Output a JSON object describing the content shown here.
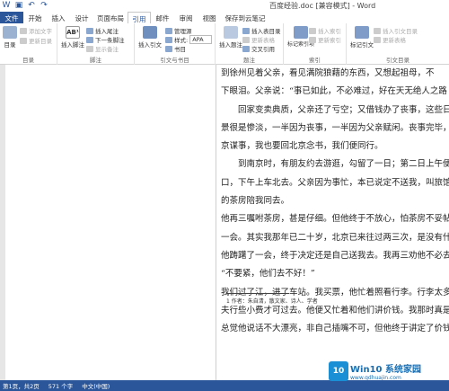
{
  "window": {
    "title": "百度经验.doc [兼容模式] - Word",
    "qat": [
      "save-icon",
      "undo-icon",
      "redo-icon"
    ]
  },
  "tabs": [
    "文件",
    "开始",
    "插入",
    "设计",
    "页面布局",
    "引用",
    "邮件",
    "审阅",
    "视图",
    "保存到云笔记"
  ],
  "active_tab": "引用",
  "ribbon": {
    "toc": {
      "big": "目录",
      "add_text": "添加文字",
      "update": "更新目录",
      "label": "目录"
    },
    "footnote": {
      "big": "插入脚注",
      "insert_endnote": "插入尾注",
      "next_footnote": "下一条脚注",
      "show_notes": "显示备注",
      "label": "脚注"
    },
    "citation": {
      "big": "插入引文",
      "manage": "管理源",
      "style_label": "样式:",
      "style_value": "APA",
      "biblio": "书目",
      "label": "引文与书目"
    },
    "caption": {
      "insert_caption": "插入题注",
      "insert_tof": "插入表目录",
      "update_table": "更新表格",
      "cross_ref": "交叉引用",
      "label": "题注"
    },
    "index": {
      "big": "标记索引项",
      "insert_index": "插入索引",
      "update_index": "更新索引",
      "label": "索引"
    },
    "toa": {
      "big": "标记引文",
      "insert_toa": "插入引文目录",
      "update_table": "更新表格",
      "label": "引文目录"
    }
  },
  "document": {
    "lines": [
      "到徐州见着父亲，看见满院狼藉的东西，又想起祖母，不",
      "下眼泪。父亲说：“事已如此，不必难过，好在天无绝人之路",
      "　　回家变卖典质，父亲还了亏空；又借钱办了丧事，这些日",
      "景很是惨淡，一半因为丧事，一半因为父亲赋闲。丧事完毕，",
      "京谋事，我也要回北京念书，我们便同行。",
      "　　到南京时，有朋友约去游逛，勾留了一日；第二日上午便",
      "口，下午上车北去。父亲因为事忙，本已说定不送我，叫旅馆",
      "的茶房陪我同去。",
      "他再三嘱咐茶房，甚是仔细。但他终于不放心，怕茶房不妥帖",
      "一会。其实我那年已二十岁，北京已来往过两三次，是没有什",
      "他踌躇了一会，终于决定还是自己送我去。我再三劝他不必去",
      "“不要紧，他们去不好！”",
      "我们过了江，进了车站。我买票，他忙着照看行李。行李太多",
      "夫行些小费才可过去。他便又忙着和他们讲价钱。我那时真是",
      "总觉他说话不大漂亮，非自己插嘴不可，但他终于讲定了价钱"
    ],
    "footnote": "1 作者：朱自清，散文家、诗人、学者"
  },
  "status": {
    "page": "第1页，共2页",
    "words": "571 个字",
    "lang": "中文(中国)"
  },
  "watermark": {
    "logo": "10",
    "name": "Win10 系统家园",
    "url": "www.qdhuajin.com"
  },
  "colors": {
    "accent": "#2b579a",
    "page_bg": "#ffffff",
    "canvas_bg": "#e6e6e6"
  }
}
